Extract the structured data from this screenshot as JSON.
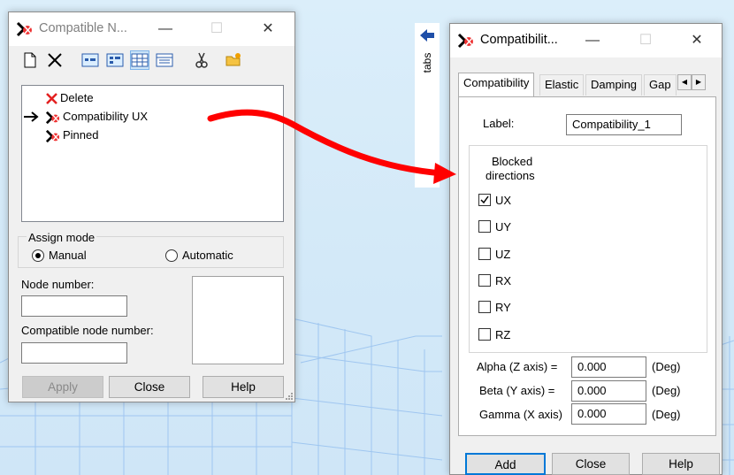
{
  "left_window": {
    "title": "Compatible N...",
    "list_items": [
      {
        "label": "Delete",
        "icon": "red-x-icon"
      },
      {
        "label": "Compatibility UX",
        "icon": "compatibility-icon",
        "selected_marker": true
      },
      {
        "label": "Pinned",
        "icon": "compatibility-icon"
      }
    ],
    "assign_mode": {
      "label": "Assign mode",
      "options": [
        "Manual",
        "Automatic"
      ],
      "selected": "Manual"
    },
    "node_number_label": "Node number:",
    "node_number_value": "",
    "compatible_node_label": "Compatible node number:",
    "compatible_node_value": "",
    "buttons": {
      "apply": "Apply",
      "close": "Close",
      "help": "Help"
    },
    "toolbar_icons": [
      "new-icon",
      "delete-icon",
      "view-1-icon",
      "view-2-icon",
      "view-table-icon",
      "view-list-icon",
      "cut-icon",
      "open-folder-icon"
    ]
  },
  "side_tab": {
    "label": "tabs",
    "icon": "arrow-left-icon"
  },
  "right_window": {
    "title": "Compatibilit...",
    "tabs": [
      "Compatibility",
      "Elastic",
      "Damping",
      "Gap"
    ],
    "active_tab": "Compatibility",
    "label_caption": "Label:",
    "label_value": "Compatibility_1",
    "blocked_title_line1": "Blocked",
    "blocked_title_line2": "directions",
    "directions": [
      {
        "name": "UX",
        "checked": true
      },
      {
        "name": "UY",
        "checked": false
      },
      {
        "name": "UZ",
        "checked": false
      },
      {
        "name": "RX",
        "checked": false
      },
      {
        "name": "RY",
        "checked": false
      },
      {
        "name": "RZ",
        "checked": false
      }
    ],
    "angles": [
      {
        "label": "Alpha (Z axis) =",
        "value": "0.000",
        "unit": "(Deg)"
      },
      {
        "label": "Beta (Y axis) =",
        "value": "0.000",
        "unit": "(Deg)"
      },
      {
        "label": "Gamma (X axis)",
        "value": "0.000",
        "unit": "(Deg)"
      }
    ],
    "buttons": {
      "add": "Add",
      "close": "Close",
      "help": "Help"
    }
  },
  "colors": {
    "annotation_arrow": "#ff0000",
    "wireframe": "#9fc6f0",
    "side_arrow": "#1f4fa8"
  }
}
